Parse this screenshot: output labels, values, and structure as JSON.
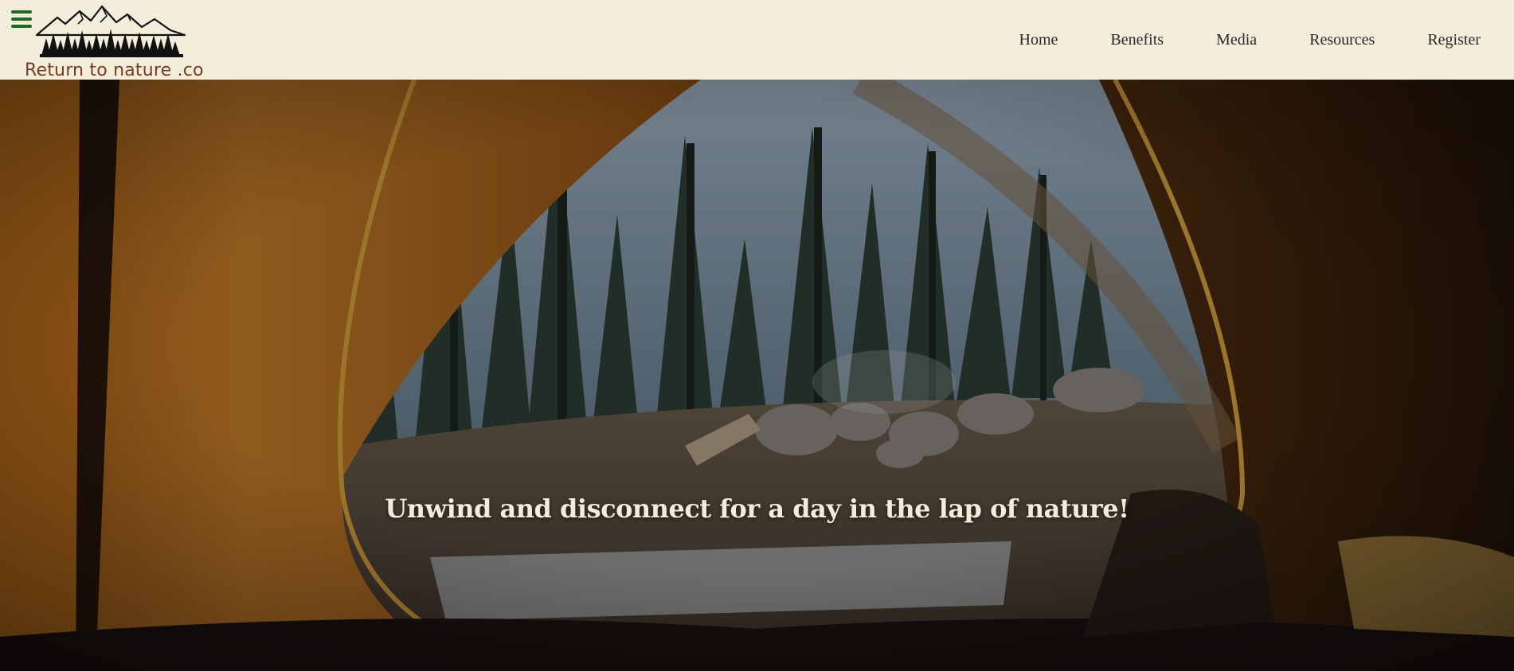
{
  "header": {
    "menu_icon": "hamburger-menu-icon",
    "logo_icon": "mountain-forest-logo-icon",
    "brand_name": "Return to nature .co",
    "brand_color": "#7a3b22",
    "accent_color": "#1e6b1e",
    "background": "#f2eedb"
  },
  "nav": {
    "items": [
      {
        "label": "Home"
      },
      {
        "label": "Benefits"
      },
      {
        "label": "Media"
      },
      {
        "label": "Resources"
      },
      {
        "label": "Register"
      }
    ]
  },
  "hero": {
    "image_subject": "view-from-inside-tent-of-forest-campsite",
    "tagline": "Unwind and disconnect for a day in the lap of nature!",
    "tagline_color": "#f4ecd8"
  }
}
